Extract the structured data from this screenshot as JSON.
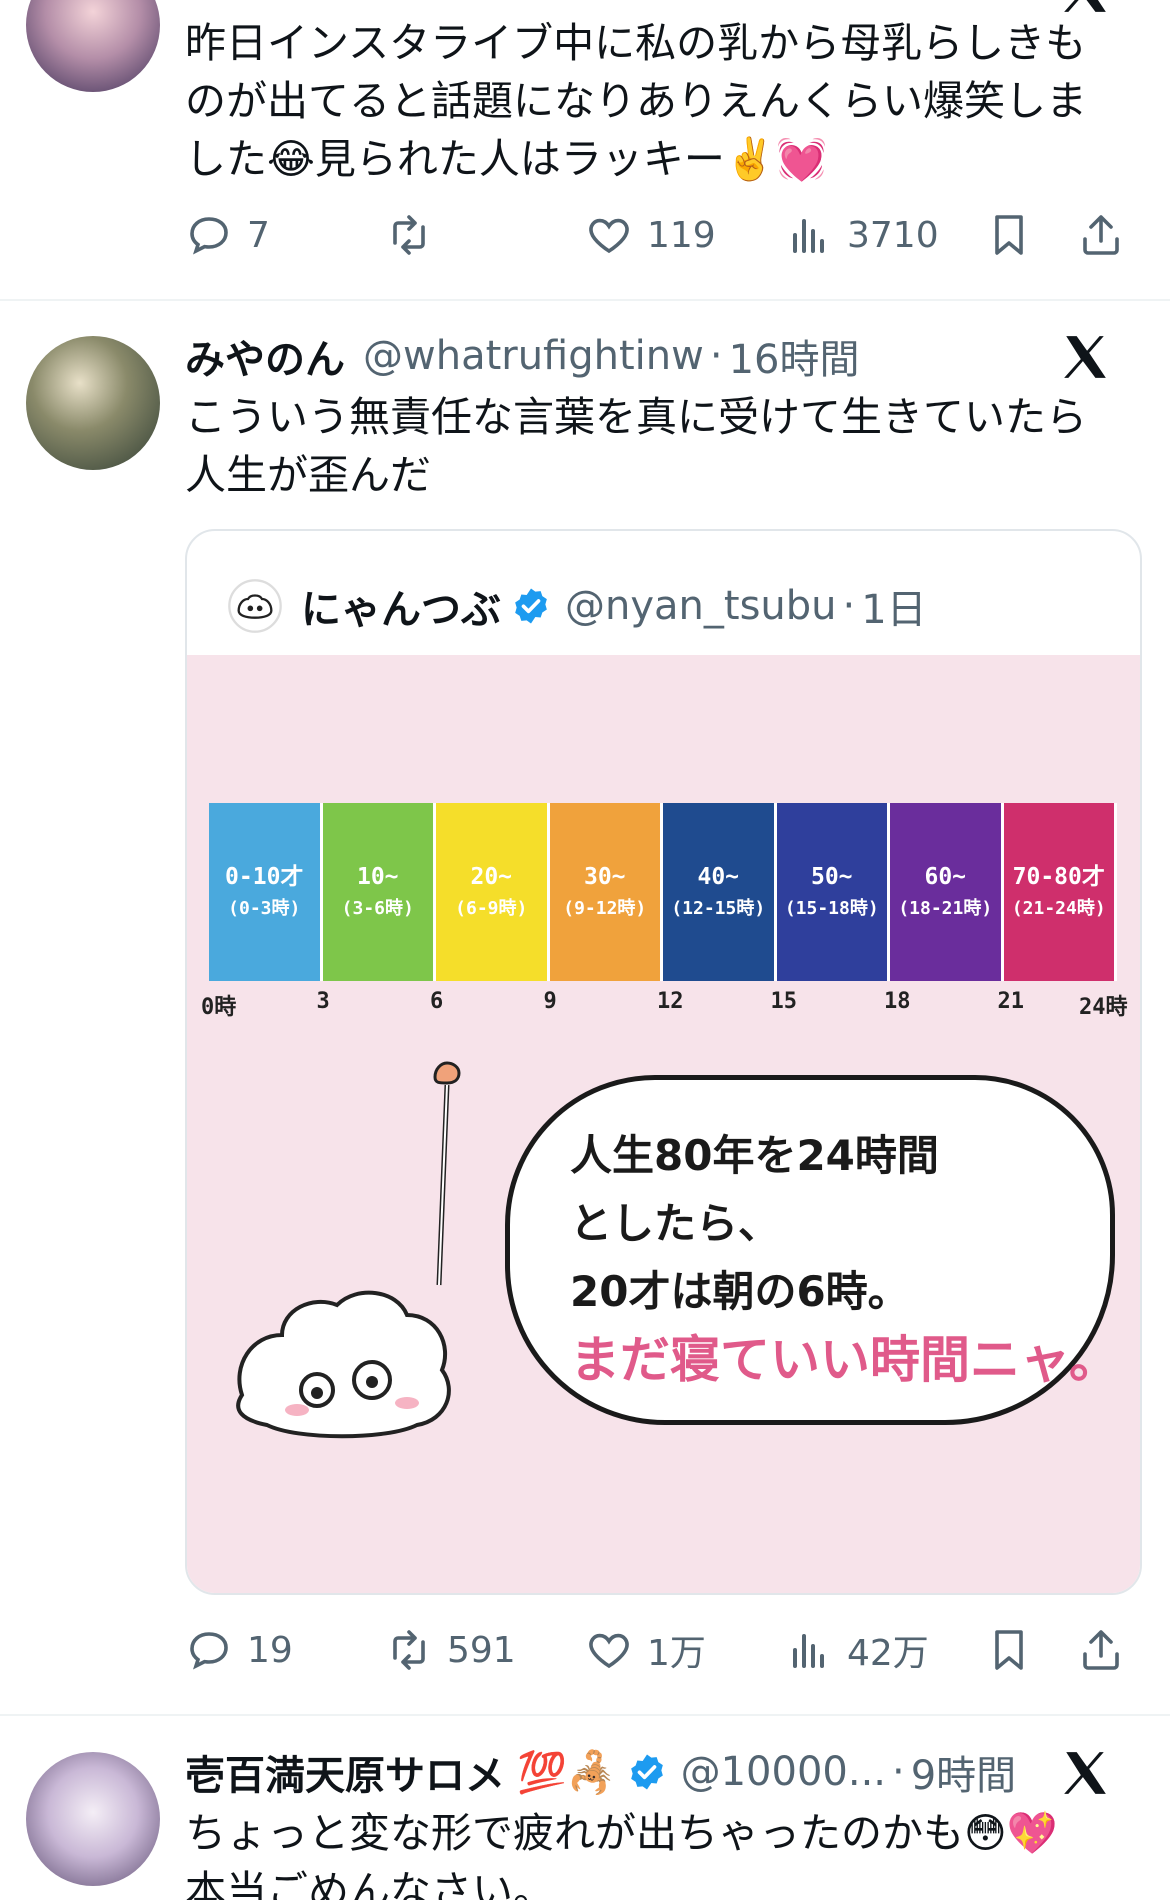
{
  "tweet1": {
    "text": "昨日インスタライブ中に私の乳から母乳らしきものが出てると話題になりありえんくらい爆笑しました😂見られた人はラッキー✌️💓",
    "stats": {
      "replies": "7",
      "retweets": "",
      "likes": "119",
      "views": "3710"
    }
  },
  "tweet2": {
    "name": "みやのん",
    "handle": "@whatrufightinw",
    "time": "16時間",
    "text": "こういう無責任な言葉を真に受けて生きていたら人生が歪んだ",
    "quote": {
      "name": "にゃんつぶ",
      "handle": "@nyan_tsubu",
      "time": "1日",
      "image": {
        "bands": [
          {
            "age": "0-10才",
            "hours": "(0-3時)",
            "color": "#4aa9dd"
          },
          {
            "age": "10~",
            "hours": "(3-6時)",
            "color": "#7ec64a"
          },
          {
            "age": "20~",
            "hours": "(6-9時)",
            "color": "#f5de2a"
          },
          {
            "age": "30~",
            "hours": "(9-12時)",
            "color": "#f0a23c"
          },
          {
            "age": "40~",
            "hours": "(12-15時)",
            "color": "#1f4b8f"
          },
          {
            "age": "50~",
            "hours": "(15-18時)",
            "color": "#2f3f9c"
          },
          {
            "age": "60~",
            "hours": "(18-21時)",
            "color": "#6a2d9c"
          },
          {
            "age": "70-80才",
            "hours": "(21-24時)",
            "color": "#cf2f6c"
          }
        ],
        "ticks": [
          "0時",
          "3",
          "6",
          "9",
          "12",
          "15",
          "18",
          "21",
          "24時"
        ],
        "bubble_line1": "人生80年を24時間",
        "bubble_line2": "としたら、",
        "bubble_line3": "20才は朝の6時。",
        "bubble_line4": "まだ寝ていい時間ニャ。"
      }
    },
    "stats": {
      "replies": "19",
      "retweets": "591",
      "likes": "1万",
      "views": "42万"
    }
  },
  "tweet3": {
    "name": "壱百満天原サロメ",
    "name_emoji": "💯🦂",
    "handle": "@10000...",
    "time": "9時間",
    "text": "ちょっと変な形で疲れが出ちゃったのかも😳💖\n本当ごめんなさい。"
  },
  "colors": {
    "verified": "#1d9bf0",
    "muted": "#536471",
    "divider": "#eff3f4"
  }
}
